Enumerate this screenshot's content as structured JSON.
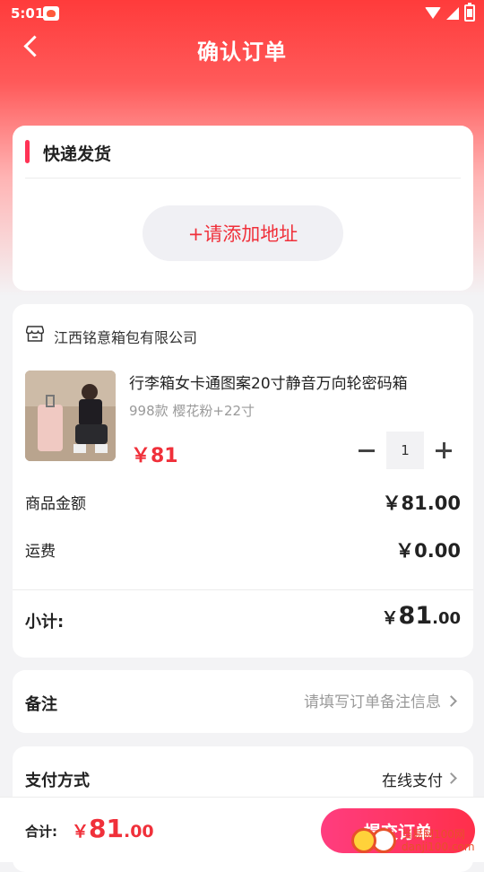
{
  "status_bar": {
    "time": "5:01"
  },
  "header": {
    "title": "确认订单"
  },
  "shipping": {
    "title": "快递发货",
    "add_address_label": "+请添加地址"
  },
  "order": {
    "shop_name": "江西铭意箱包有限公司",
    "product": {
      "name": "行李箱女卡通图案20寸静音万向轮密码箱",
      "spec": "998款 樱花粉+22寸",
      "price": "￥81",
      "quantity": "1"
    },
    "goods_amount_label": "商品金额",
    "goods_amount_value": "￥81.00",
    "shipping_fee_label": "运费",
    "shipping_fee_value": "￥0.00",
    "subtotal_label": "小计:",
    "subtotal_currency": "￥",
    "subtotal_int": "81",
    "subtotal_dec": ".00"
  },
  "remarks": {
    "label": "备注",
    "placeholder": "请填写订单备注信息"
  },
  "payment": {
    "label": "支付方式",
    "value": "在线支付"
  },
  "footer": {
    "total_label": "合计:",
    "total_currency": "￥",
    "total_int": "81",
    "total_dec": ".00",
    "submit_label": "提交订单"
  },
  "watermark": {
    "text_top": "当易网100网",
    "text_bottom": "danji100.com"
  },
  "colors": {
    "accent": "#f0303a",
    "header_red": "#ff3b3b",
    "button_pink": "#ff3d7f"
  }
}
